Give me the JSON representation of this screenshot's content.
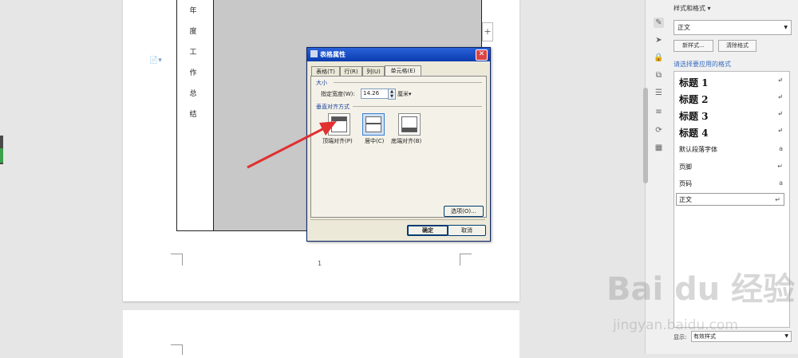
{
  "document": {
    "vertical_text": [
      "年",
      "度",
      "工",
      "作",
      "总",
      "结"
    ],
    "page_number": "1"
  },
  "dialog": {
    "title": "表格属性",
    "close_glyph": "✕",
    "tabs": [
      "表格(T)",
      "行(R)",
      "列(U)",
      "单元格(E)"
    ],
    "size_group": "大小",
    "width_label": "指定宽度(W):",
    "width_value": "14.26",
    "width_unit": "厘米▾",
    "valign_group": "垂直对齐方式",
    "valign_options": [
      "顶端对齐(P)",
      "居中(C)",
      "底端对齐(B)"
    ],
    "options_button": "选项(O)...",
    "ok_button": "确定",
    "cancel_button": "取消"
  },
  "style_panel": {
    "title": "样式和格式 ▾",
    "current_style": "正文",
    "new_style_button": "新样式...",
    "clear_format_button": "清除格式",
    "choose_label": "请选择要应用的格式",
    "styles": [
      {
        "name": "标题 1",
        "mark": "↵"
      },
      {
        "name": "标题 2",
        "mark": "↵"
      },
      {
        "name": "标题 3",
        "mark": "↵"
      },
      {
        "name": "标题 4",
        "mark": "↵"
      },
      {
        "name": "默认段落字体",
        "mark": "a"
      },
      {
        "name": "页脚",
        "mark": "↵"
      },
      {
        "name": "页码",
        "mark": "a"
      },
      {
        "name": "正文",
        "mark": "↵"
      }
    ],
    "show_label": "显示:",
    "show_value": "有效样式"
  },
  "watermark": {
    "brand": "Bai du 经验",
    "url": "jingyan.baidu.com"
  },
  "colors": {
    "dialog_title": "#0a3cb0",
    "arrow": "#e03030",
    "accent_link": "#3a6fc0"
  }
}
